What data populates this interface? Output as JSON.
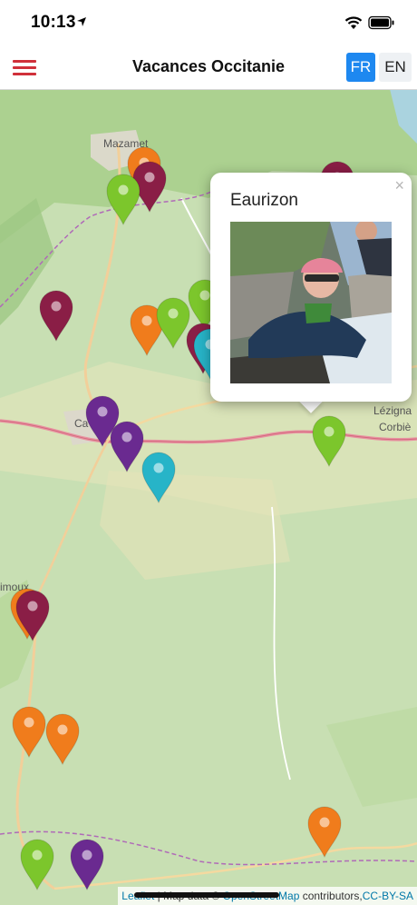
{
  "status_bar": {
    "time": "10:13"
  },
  "header": {
    "title": "Vacances Occitanie",
    "lang_fr": "FR",
    "lang_en": "EN",
    "active_lang": "FR"
  },
  "colors": {
    "accent": "#d0303a",
    "active_lang": "#1e88f0",
    "marker_orange": "#f07c1c",
    "marker_green": "#7cc62c",
    "marker_purple": "#6a2a90",
    "marker_maroon": "#8a1e46",
    "marker_teal": "#27b4c8"
  },
  "map": {
    "place_labels": [
      "Mazamet",
      "Ca",
      "Lézigna",
      "Corbiè",
      "imoux"
    ],
    "markers": [
      {
        "category": "orange"
      },
      {
        "category": "maroon"
      },
      {
        "category": "green"
      },
      {
        "category": "maroon"
      },
      {
        "category": "orange"
      },
      {
        "category": "green"
      },
      {
        "category": "green"
      },
      {
        "category": "maroon"
      },
      {
        "category": "teal"
      },
      {
        "category": "maroon"
      },
      {
        "category": "purple"
      },
      {
        "category": "purple"
      },
      {
        "category": "teal"
      },
      {
        "category": "green"
      },
      {
        "category": "orange"
      },
      {
        "category": "maroon"
      },
      {
        "category": "orange"
      },
      {
        "category": "orange"
      },
      {
        "category": "orange"
      },
      {
        "category": "green"
      },
      {
        "category": "purple"
      }
    ],
    "popup": {
      "title": "Eaurizon",
      "close": "×",
      "image_icon": "canyoning-photo"
    }
  },
  "attribution": {
    "leaflet": "Leaflet",
    "separator": " | ",
    "map_data": "Map data © ",
    "osm": "OpenStreetMap",
    "contributors": " contributors,",
    "license": "CC-BY-SA"
  }
}
